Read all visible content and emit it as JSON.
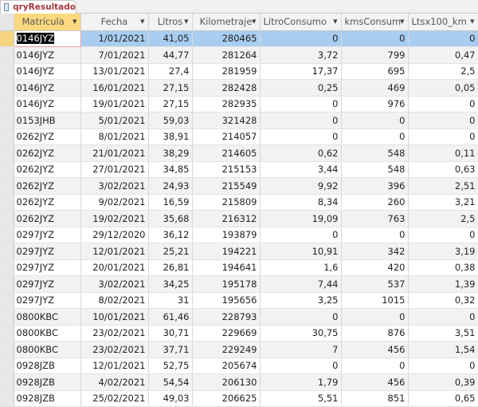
{
  "tab": {
    "title": "qryResultado"
  },
  "columns": [
    "Matrícula",
    "Fecha",
    "Litros",
    "Kilometraje",
    "LitroConsumo",
    "kmsConsum",
    "Ltsx100_km"
  ],
  "rows": [
    [
      "0146JYZ",
      "1/01/2021",
      "41,05",
      "280465",
      "0",
      "0",
      "0"
    ],
    [
      "0146JYZ",
      "7/01/2021",
      "44,77",
      "281264",
      "3,72",
      "799",
      "0,47"
    ],
    [
      "0146JYZ",
      "13/01/2021",
      "27,4",
      "281959",
      "17,37",
      "695",
      "2,5"
    ],
    [
      "0146JYZ",
      "16/01/2021",
      "27,15",
      "282428",
      "0,25",
      "469",
      "0,05"
    ],
    [
      "0146JYZ",
      "19/01/2021",
      "27,15",
      "282935",
      "0",
      "976",
      "0"
    ],
    [
      "0153JHB",
      "5/01/2021",
      "59,03",
      "321428",
      "0",
      "0",
      "0"
    ],
    [
      "0262JYZ",
      "8/01/2021",
      "38,91",
      "214057",
      "0",
      "0",
      "0"
    ],
    [
      "0262JYZ",
      "21/01/2021",
      "38,29",
      "214605",
      "0,62",
      "548",
      "0,11"
    ],
    [
      "0262JYZ",
      "27/01/2021",
      "34,85",
      "215153",
      "3,44",
      "548",
      "0,63"
    ],
    [
      "0262JYZ",
      "3/02/2021",
      "24,93",
      "215549",
      "9,92",
      "396",
      "2,51"
    ],
    [
      "0262JYZ",
      "9/02/2021",
      "16,59",
      "215809",
      "8,34",
      "260",
      "3,21"
    ],
    [
      "0262JYZ",
      "19/02/2021",
      "35,68",
      "216312",
      "19,09",
      "763",
      "2,5"
    ],
    [
      "0297JYZ",
      "29/12/2020",
      "36,12",
      "193879",
      "0",
      "0",
      "0"
    ],
    [
      "0297JYZ",
      "12/01/2021",
      "25,21",
      "194221",
      "10,91",
      "342",
      "3,19"
    ],
    [
      "0297JYZ",
      "20/01/2021",
      "26,81",
      "194641",
      "1,6",
      "420",
      "0,38"
    ],
    [
      "0297JYZ",
      "3/02/2021",
      "34,25",
      "195178",
      "7,44",
      "537",
      "1,39"
    ],
    [
      "0297JYZ",
      "8/02/2021",
      "31",
      "195656",
      "3,25",
      "1015",
      "0,32"
    ],
    [
      "0800KBC",
      "10/01/2021",
      "61,46",
      "228793",
      "0",
      "0",
      "0"
    ],
    [
      "0800KBC",
      "23/02/2021",
      "30,71",
      "229669",
      "30,75",
      "876",
      "3,51"
    ],
    [
      "0800KBC",
      "23/02/2021",
      "37,71",
      "229249",
      "7",
      "456",
      "1,54"
    ],
    [
      "0928JZB",
      "12/01/2021",
      "52,75",
      "205674",
      "0",
      "0",
      "0"
    ],
    [
      "0928JZB",
      "4/02/2021",
      "54,54",
      "206130",
      "1,79",
      "456",
      "0,39"
    ],
    [
      "0928JZB",
      "25/02/2021",
      "49,03",
      "206625",
      "5,51",
      "851",
      "0,65"
    ]
  ]
}
